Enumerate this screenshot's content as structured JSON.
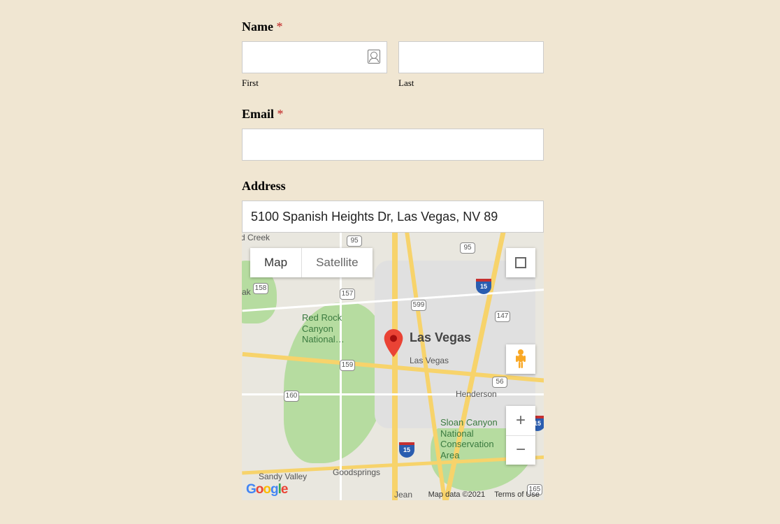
{
  "form": {
    "name_label": "Name",
    "required_mark": "*",
    "first_sublabel": "First",
    "last_sublabel": "Last",
    "first_value": "",
    "last_value": "",
    "email_label": "Email",
    "email_value": "",
    "address_label": "Address",
    "address_value": "5100 Spanish Heights Dr, Las Vegas, NV 89"
  },
  "map": {
    "type_map": "Map",
    "type_satellite": "Satellite",
    "zoom_in": "+",
    "zoom_out": "−",
    "attribution_data": "Map data ©2021",
    "attribution_terms": "Terms of Use",
    "google": {
      "g1": "G",
      "o1": "o",
      "o2": "o",
      "g2": "g",
      "l": "l",
      "e": "e"
    },
    "labels": {
      "creek": "d Creek",
      "ak": "ak",
      "redrock": "Red Rock\nCanyon\nNational…",
      "lasvegas_big": "Las Vegas",
      "lasvegas_small": "Las Vegas",
      "henderson": "Henderson",
      "sloan": "Sloan Canyon\nNational\nConservation\nArea",
      "sandy": "Sandy Valley",
      "goodsprings": "Goodsprings",
      "jean": "Jean"
    },
    "routes": {
      "r95a": "95",
      "r95b": "95",
      "r158": "158",
      "r157": "157",
      "r599": "599",
      "r147": "147",
      "r159": "159",
      "r160": "160",
      "r56": "56",
      "r165": "165",
      "i15a": "15",
      "i15b": "15",
      "i15c": "15"
    }
  }
}
